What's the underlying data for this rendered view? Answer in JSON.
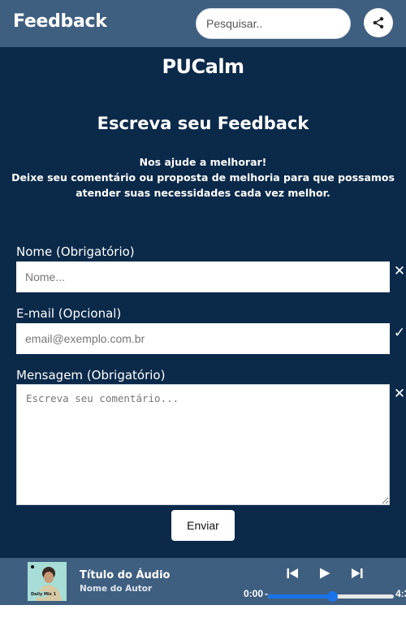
{
  "header": {
    "title": "Feedback",
    "search_placeholder": "Pesquisar..",
    "share_icon": "share-icon"
  },
  "main": {
    "brand": "PUCalm",
    "heading": "Escreva seu Feedback",
    "intro_line1": "Nos ajude a melhorar!",
    "intro_line2": "Deixe seu comentário ou proposta de melhoria para que possamos atender suas necessidades cada vez melhor."
  },
  "form": {
    "name_label": "Nome (Obrigatório)",
    "name_placeholder": "Nome...",
    "name_value": "",
    "name_status": "✕",
    "email_label": "E-mail (Opcional)",
    "email_placeholder": "email@exemplo.com.br",
    "email_value": "",
    "email_status": "✓",
    "message_label": "Mensagem (Obrigatório)",
    "message_placeholder": "Escreva seu comentário...",
    "message_value": "",
    "message_status": "✕",
    "submit_label": "Enviar"
  },
  "player": {
    "cover_text": "Daily Mix 1",
    "title": "Título do Áudio",
    "author": "Nome do Autor",
    "current_time": "0:00",
    "total_time": "4:3",
    "progress": 0.51,
    "colors": {
      "accent": "#1a73e8",
      "bar": "#3f5f80",
      "background": "#0b2a4a"
    }
  }
}
